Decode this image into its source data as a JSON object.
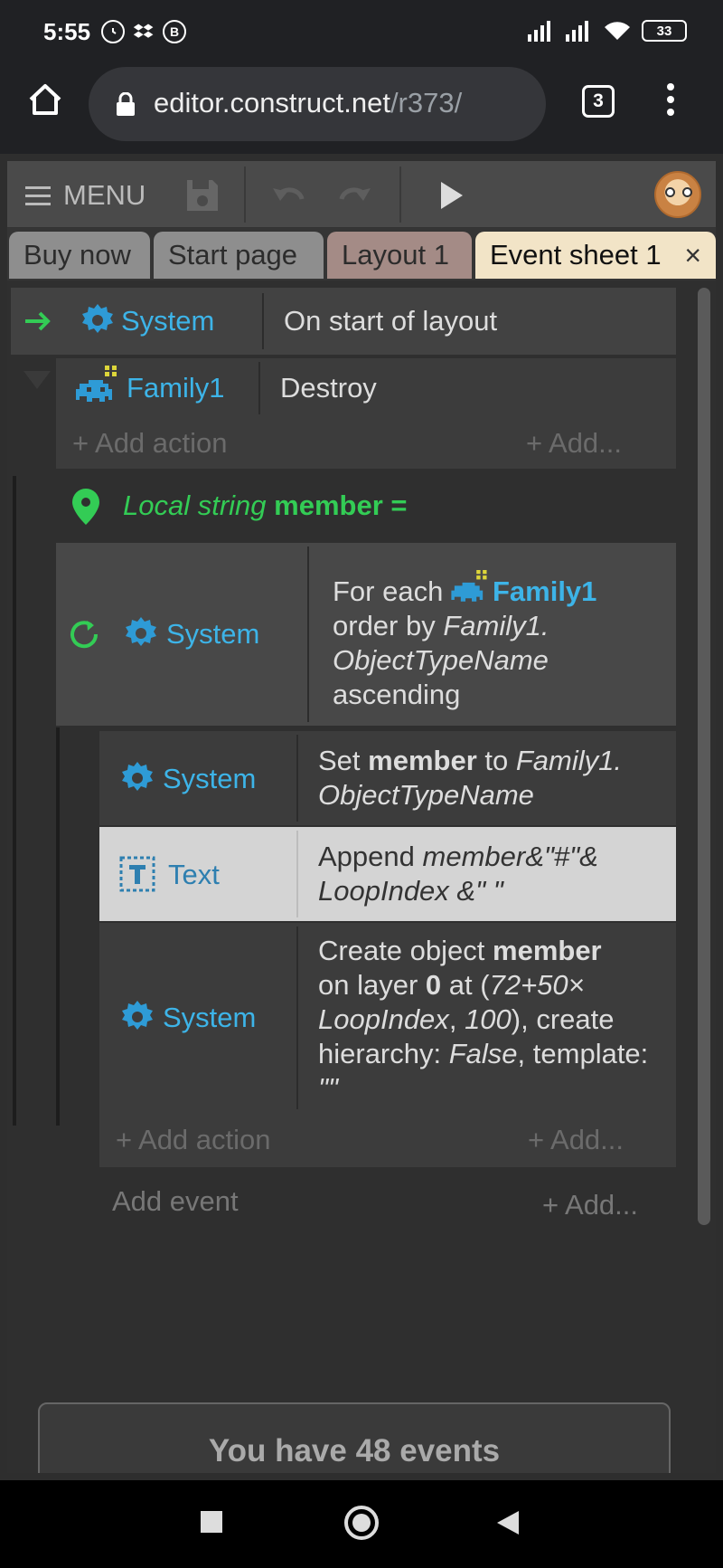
{
  "status_bar": {
    "time": "5:55",
    "notif_b": "B",
    "battery": "33"
  },
  "browser": {
    "url_host": "editor.construct.net",
    "url_path": "/r373/",
    "tab_count": "3"
  },
  "toolbar": {
    "menu_label": "MENU"
  },
  "tabs": [
    {
      "label": "Buy now"
    },
    {
      "label": "Start page"
    },
    {
      "label": "Layout 1"
    },
    {
      "label": "Event sheet 1",
      "close": "×"
    }
  ],
  "event1": {
    "condition_object": "System",
    "condition_text": "On start of layout",
    "action_object": "Family1",
    "action_text": "Destroy",
    "add_action": "Add action",
    "add_more": "Add..."
  },
  "local_var": {
    "prefix": "Local string",
    "name": "member",
    "suffix": "="
  },
  "event2": {
    "condition_object": "System",
    "cond_for_each": "For each",
    "cond_family": "Family1",
    "cond_order_by": "order by",
    "cond_expr_1": "Family1.",
    "cond_expr_2": "ObjectTypeName",
    "cond_sort": "ascending",
    "actions": [
      {
        "object": "System",
        "set": "Set",
        "var": "member",
        "to": "to",
        "expr_1": "Family1.",
        "expr_2": "ObjectTypeName"
      },
      {
        "object": "Text",
        "append": "Append",
        "expr_1": "member&\"#\"&",
        "expr_2": "LoopIndex &\" \""
      },
      {
        "object": "System",
        "line1_a": "Create object",
        "line1_b": "member",
        "line2_a": "on layer",
        "line2_b": "0",
        "line2_c": "at (",
        "line2_d": "72+50×",
        "line3_a": "LoopIndex",
        "line3_b": ",",
        "line3_c": "100",
        "line3_d": "), create",
        "line4_a": "hierarchy:",
        "line4_b": "False",
        "line4_c": ", template:",
        "line5": "\"\""
      }
    ],
    "add_action": "Add action",
    "add_more": "Add..."
  },
  "footer": {
    "add_event": "Add event",
    "add_more": "Add...",
    "events_count": "You have 48 events"
  }
}
